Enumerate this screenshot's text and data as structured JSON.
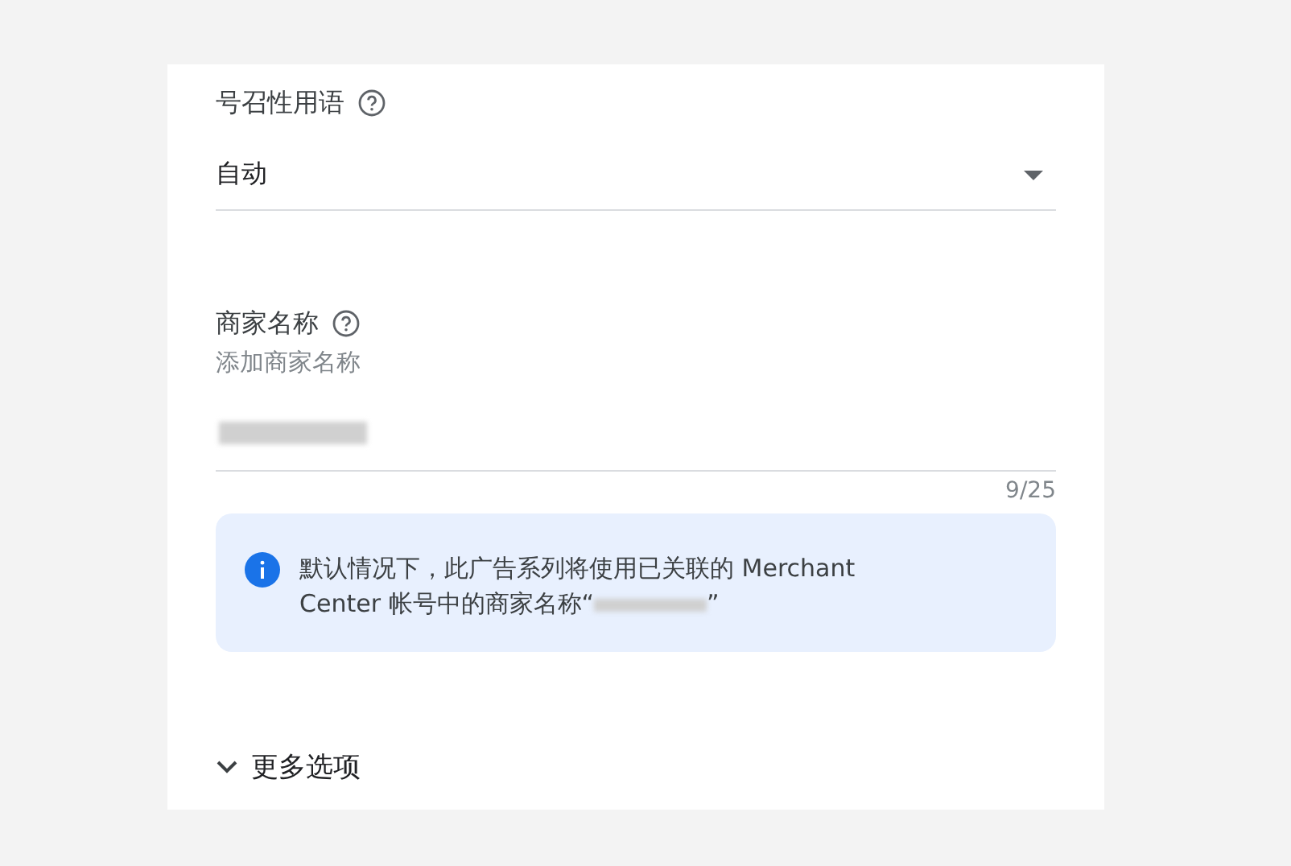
{
  "call_to_action": {
    "label": "号召性用语",
    "value": "自动"
  },
  "business_name": {
    "label": "商家名称",
    "hint": "添加商家名称",
    "counter": "9/25"
  },
  "info": {
    "text": "默认情况下，此广告系列将使用已关联的 Merchant Center 帐号中的商家名称“",
    "closing": "”"
  },
  "more_options": {
    "label": "更多选项",
    "expanded": false
  }
}
